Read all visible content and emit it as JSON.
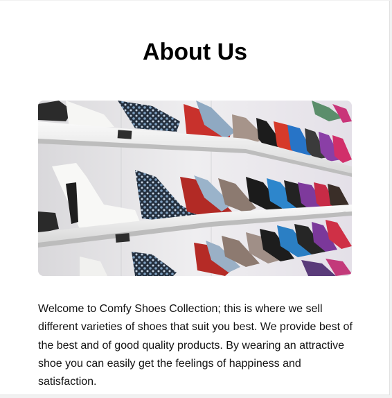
{
  "page": {
    "title": "About Us"
  },
  "hero": {
    "icon": "shoe-shelf-photo"
  },
  "about": {
    "paragraph": "Welcome to Comfy Shoes Collection; this is where we sell different varieties of shoes that suit you best. We provide best of the best and of good quality products. By wearing an attractive shoe you can easily get the feelings of happiness and satisfaction."
  },
  "colors": {
    "background": "#ffffff",
    "text": "#111111",
    "title": "#000000"
  }
}
